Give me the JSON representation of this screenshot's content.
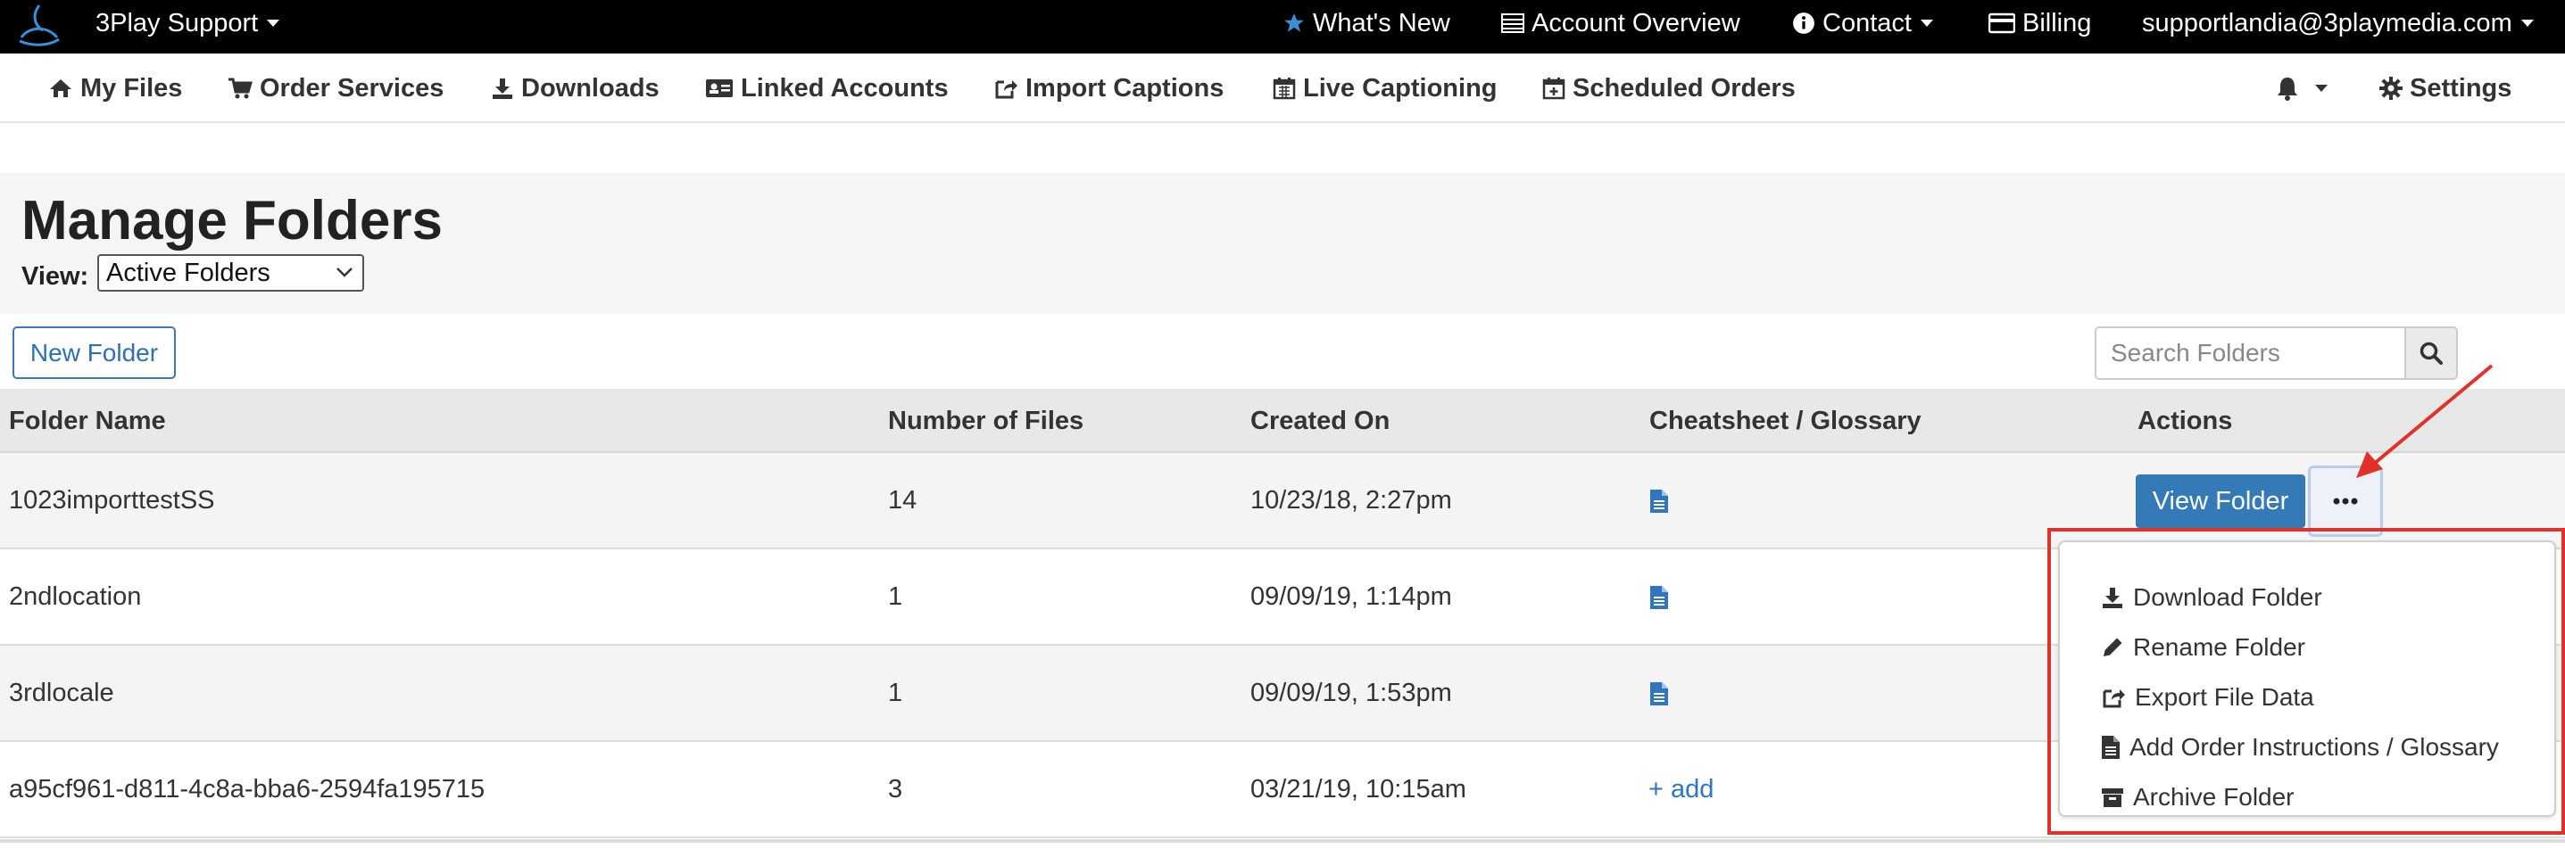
{
  "topbar": {
    "brand": "3Play Support",
    "whats_new": "What's New",
    "account_overview": "Account Overview",
    "contact": "Contact",
    "billing": "Billing",
    "user_email": "supportlandia@3playmedia.com"
  },
  "nav": {
    "my_files": "My Files",
    "order_services": "Order Services",
    "downloads": "Downloads",
    "linked_accounts": "Linked Accounts",
    "import_captions": "Import Captions",
    "live_captioning": "Live Captioning",
    "scheduled_orders": "Scheduled Orders",
    "settings": "Settings"
  },
  "page": {
    "title": "Manage Folders",
    "view_label": "View:",
    "view_value": "Active Folders"
  },
  "toolbar": {
    "new_folder": "New Folder",
    "search_placeholder": "Search Folders"
  },
  "table": {
    "headers": [
      "Folder Name",
      "Number of Files",
      "Created On",
      "Cheatsheet / Glossary",
      "Actions"
    ],
    "rows": [
      {
        "name": "1023importtestSS",
        "files": "14",
        "created": "10/23/18, 2:27pm",
        "glossary": "doc"
      },
      {
        "name": "2ndlocation",
        "files": "1",
        "created": "09/09/19, 1:14pm",
        "glossary": "doc"
      },
      {
        "name": "3rdlocale",
        "files": "1",
        "created": "09/09/19, 1:53pm",
        "glossary": "doc"
      },
      {
        "name": "a95cf961-d811-4c8a-bba6-2594fa195715",
        "files": "3",
        "created": "03/21/19, 10:15am",
        "glossary": "+ add"
      }
    ],
    "view_folder": "View Folder"
  },
  "dropdown": {
    "items": [
      "Download Folder",
      "Rename Folder",
      "Export File Data",
      "Add Order Instructions / Glossary",
      "Archive Folder"
    ]
  },
  "colors": {
    "primary": "#337ab7",
    "link": "#2f75c0",
    "annotation": "#e0312a"
  }
}
